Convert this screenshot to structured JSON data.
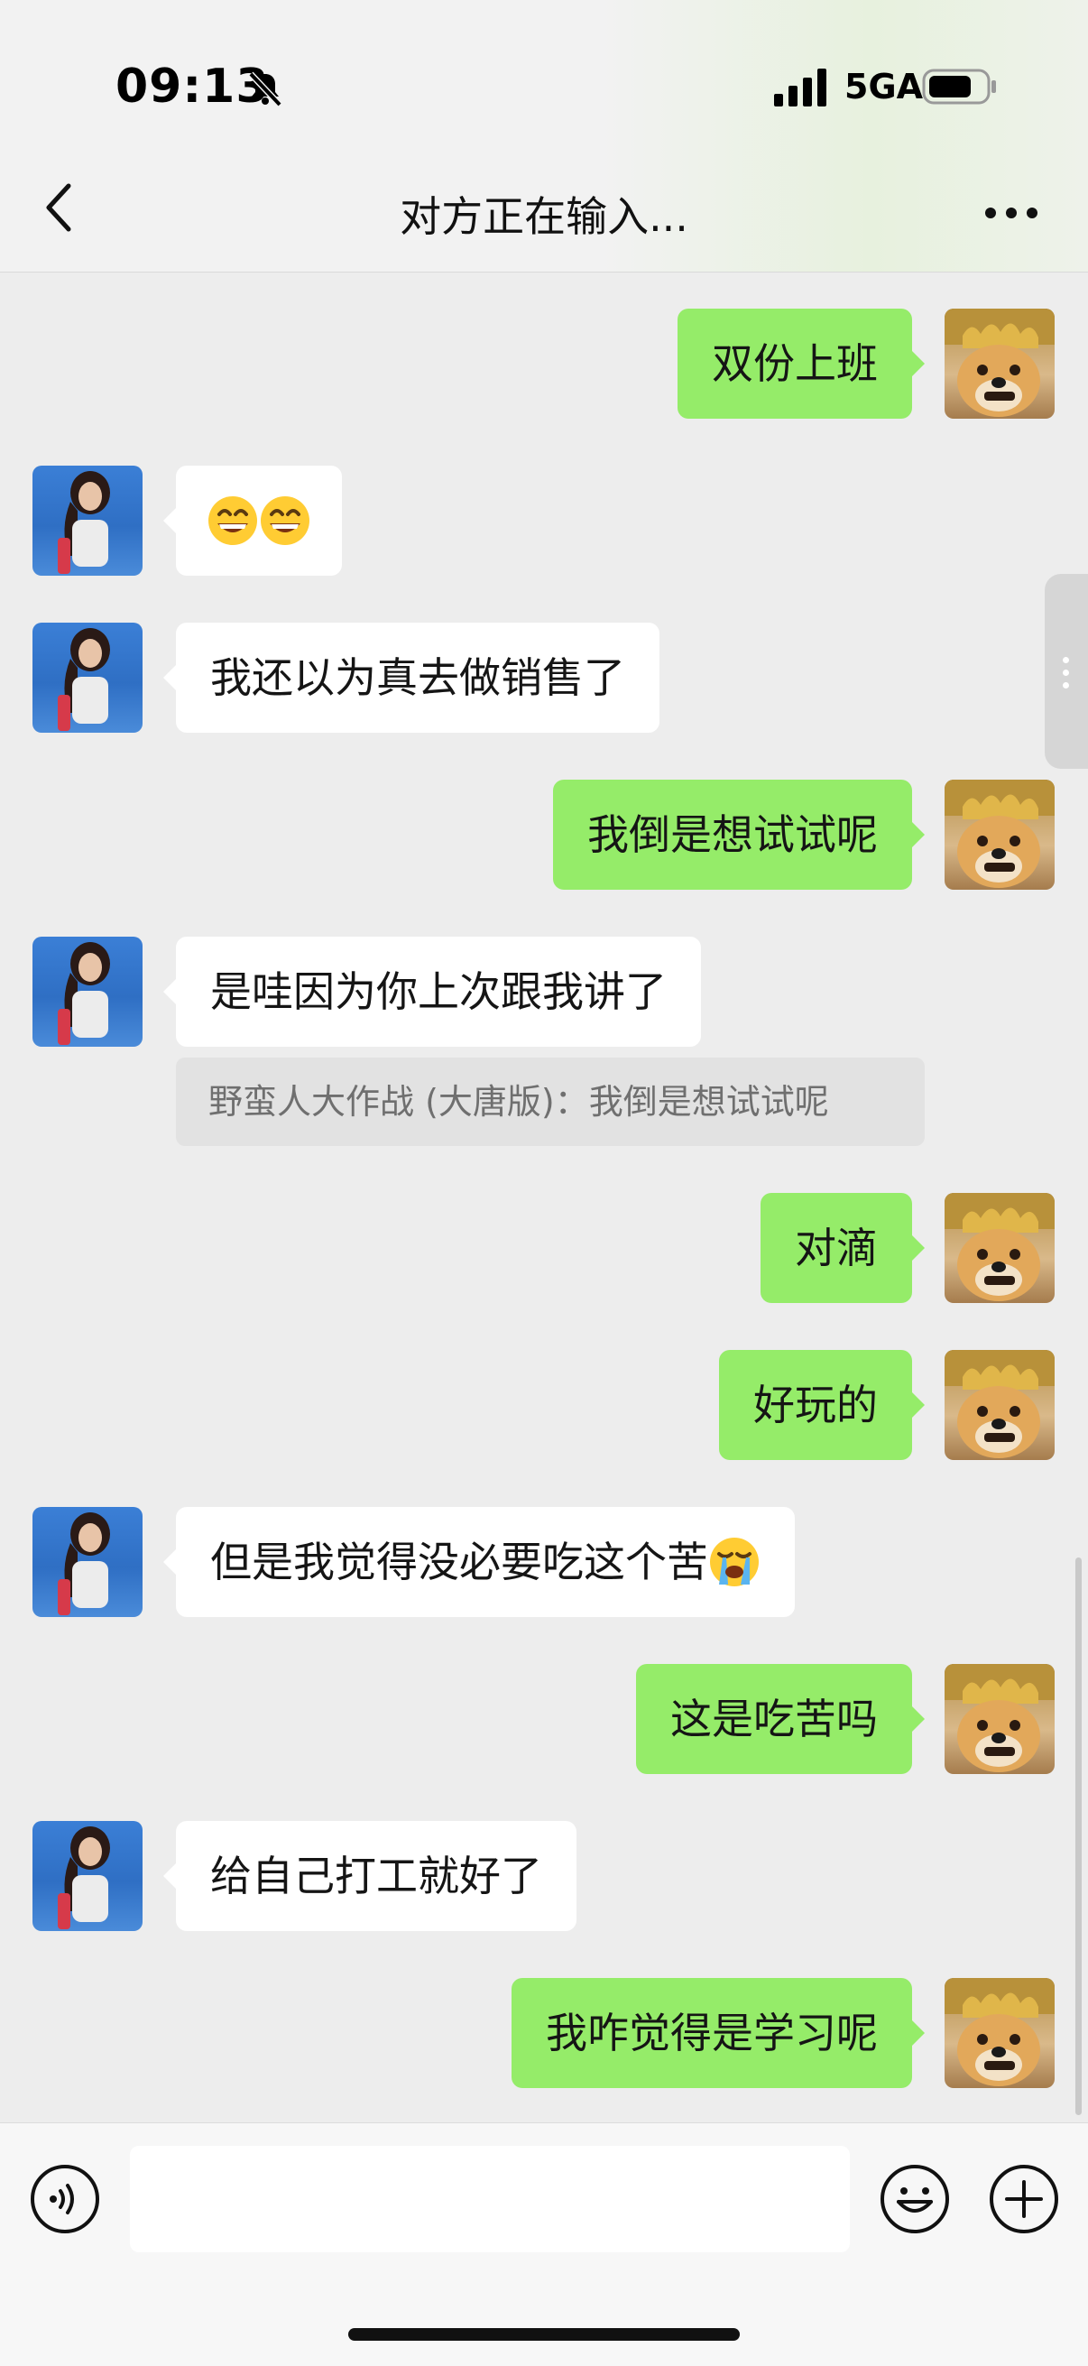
{
  "status_bar": {
    "time": "09:13",
    "network": "5GA",
    "icons": [
      "bell-muted-icon",
      "cellular-signal-icon",
      "battery-icon"
    ]
  },
  "header": {
    "title": "对方正在输入...",
    "back_icon": "chevron-left-icon",
    "more_icon": "more-dots-icon"
  },
  "messages": [
    {
      "side": "out",
      "text": "双份上班"
    },
    {
      "side": "in",
      "text": "",
      "emojis": [
        "grinning-face",
        "grinning-face"
      ]
    },
    {
      "side": "in",
      "text": "我还以为真去做销售了"
    },
    {
      "side": "out",
      "text": "我倒是想试试呢"
    },
    {
      "side": "in",
      "text": "是哇因为你上次跟我讲了",
      "quote": "野蛮人大作战 (大唐版)：我倒是想试试呢"
    },
    {
      "side": "out",
      "text": "对滴"
    },
    {
      "side": "out",
      "text": "好玩的"
    },
    {
      "side": "in",
      "text": "但是我觉得没必要吃这个苦",
      "emojis": [
        "loudly-crying-face"
      ]
    },
    {
      "side": "out",
      "text": "这是吃苦吗"
    },
    {
      "side": "in",
      "text": "给自己打工就好了"
    },
    {
      "side": "out",
      "text": "我咋觉得是学习呢"
    }
  ],
  "input_bar": {
    "voice_icon": "voice-icon",
    "input_value": "",
    "emoji_icon": "emoji-icon",
    "plus_icon": "plus-icon"
  },
  "colors": {
    "outgoing_bubble": "#95ec69",
    "incoming_bubble": "#ffffff",
    "chat_background": "#ededed"
  }
}
